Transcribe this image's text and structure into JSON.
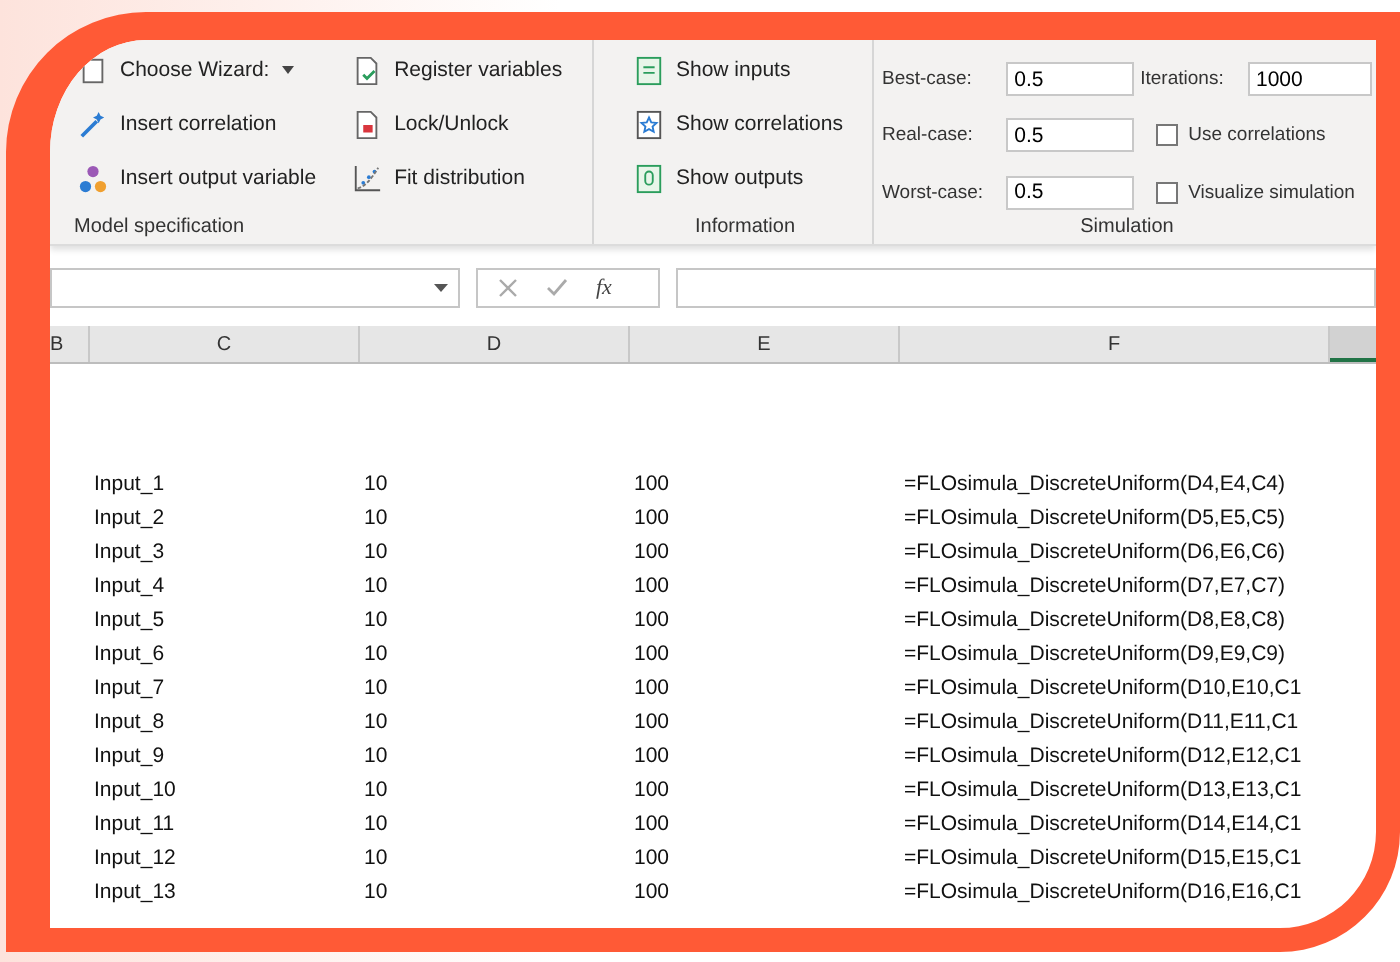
{
  "ribbon": {
    "groups": [
      {
        "label": "Model specification",
        "kind": "commands",
        "columns": [
          [
            {
              "label": "Choose Wizard:",
              "dropdown": true
            },
            {
              "label": "Insert correlation"
            },
            {
              "label": "Insert output variable"
            }
          ],
          [
            {
              "label": "Register variables"
            },
            {
              "label": "Lock/Unlock"
            },
            {
              "label": "Fit distribution"
            }
          ]
        ]
      },
      {
        "label": "Information",
        "kind": "commands",
        "columns": [
          [
            {
              "label": "Show inputs"
            },
            {
              "label": "Show correlations"
            },
            {
              "label": "Show outputs"
            }
          ]
        ]
      },
      {
        "label": "Simulation",
        "kind": "simulation",
        "fields": [
          {
            "label": "Best-case:",
            "value": "0.5"
          },
          {
            "label": "Real-case:",
            "value": "0.5"
          },
          {
            "label": "Worst-case:",
            "value": "0.5"
          }
        ],
        "iterations": {
          "label": "Iterations:",
          "value": "1000"
        },
        "checkboxes": [
          {
            "label": "Use correlations",
            "checked": false
          },
          {
            "label": "Visualize simulation",
            "checked": false
          }
        ]
      }
    ]
  },
  "formula_bar": {
    "fx": "fx"
  },
  "sheet": {
    "columns": [
      "B",
      "C",
      "D",
      "E",
      "F"
    ],
    "rows": [
      [
        "Input_1",
        "10",
        "100",
        "=FLOsimula_DiscreteUniform(D4,E4,C4)"
      ],
      [
        "Input_2",
        "10",
        "100",
        "=FLOsimula_DiscreteUniform(D5,E5,C5)"
      ],
      [
        "Input_3",
        "10",
        "100",
        "=FLOsimula_DiscreteUniform(D6,E6,C6)"
      ],
      [
        "Input_4",
        "10",
        "100",
        "=FLOsimula_DiscreteUniform(D7,E7,C7)"
      ],
      [
        "Input_5",
        "10",
        "100",
        "=FLOsimula_DiscreteUniform(D8,E8,C8)"
      ],
      [
        "Input_6",
        "10",
        "100",
        "=FLOsimula_DiscreteUniform(D9,E9,C9)"
      ],
      [
        "Input_7",
        "10",
        "100",
        "=FLOsimula_DiscreteUniform(D10,E10,C1"
      ],
      [
        "Input_8",
        "10",
        "100",
        "=FLOsimula_DiscreteUniform(D11,E11,C1"
      ],
      [
        "Input_9",
        "10",
        "100",
        "=FLOsimula_DiscreteUniform(D12,E12,C1"
      ],
      [
        "Input_10",
        "10",
        "100",
        "=FLOsimula_DiscreteUniform(D13,E13,C1"
      ],
      [
        "Input_11",
        "10",
        "100",
        "=FLOsimula_DiscreteUniform(D14,E14,C1"
      ],
      [
        "Input_12",
        "10",
        "100",
        "=FLOsimula_DiscreteUniform(D15,E15,C1"
      ],
      [
        "Input_13",
        "10",
        "100",
        "=FLOsimula_DiscreteUniform(D16,E16,C1"
      ]
    ]
  }
}
